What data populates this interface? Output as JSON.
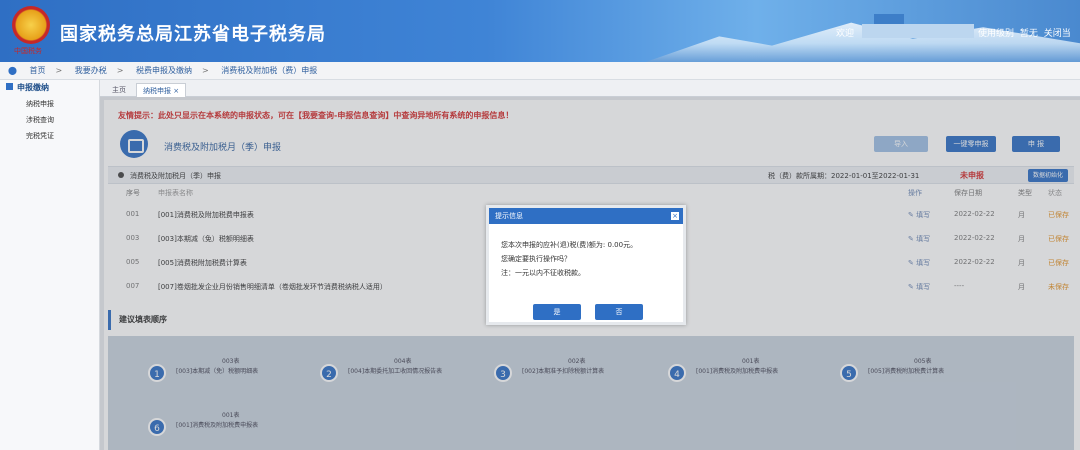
{
  "header": {
    "site_title": "国家税务总局江苏省电子税务局",
    "emblem_text": "中国税务",
    "welcome": "欢迎",
    "links": [
      "使用级别",
      "暂无",
      "关闭当"
    ]
  },
  "breadcrumb": [
    "首页",
    "我要办税",
    "税费申报及缴纳",
    "消费税及附加税（费）申报"
  ],
  "sidebar": {
    "heading": "申报缴纳",
    "items": [
      "纳税申报",
      "涉税查询",
      "完税凭证"
    ]
  },
  "tabs": {
    "home": "主页",
    "active": "纳税申报 ×"
  },
  "main": {
    "tip": "友情提示：此处只显示在本系统的申报状态，可在【我要查询-申报信息查询】中查询异地所有系统的申报信息！",
    "form_title": "消费税及附加税月（季）申报",
    "buttons": [
      "导入",
      "一键零申报",
      "申 报"
    ],
    "bar_label": "消费税及附加税月（季）申报",
    "period": "税（费）款所属期：2022-01-01至2022-01-31",
    "status": "未申报",
    "bar_button": "数据初始化",
    "columns": {
      "no": "序号",
      "name": "申报表名称",
      "op": "操作",
      "date": "保存日期",
      "type": "类型",
      "status": "状态"
    },
    "rows": [
      {
        "no": "001",
        "name": "[001]消费税及附加税费申报表",
        "op": "✎ 填写",
        "date": "2022-02-22",
        "type": "月",
        "status": "已保存"
      },
      {
        "no": "003",
        "name": "[003]本期减（免）税额明细表",
        "op": "✎ 填写",
        "date": "2022-02-22",
        "type": "月",
        "status": "已保存"
      },
      {
        "no": "005",
        "name": "[005]消费税附加税费计算表",
        "op": "✎ 填写",
        "date": "2022-02-22",
        "type": "月",
        "status": "已保存"
      },
      {
        "no": "007",
        "name": "[007]卷烟批发企业月份销售明细清单（卷烟批发环节消费税纳税人适用）",
        "op": "✎ 填写",
        "date": "----",
        "type": "月",
        "status": "未保存"
      }
    ],
    "suggest_heading": "建议填表顺序",
    "steps": [
      {
        "num": "1",
        "code": "003表",
        "name": "[003]本期减（免）税额明细表"
      },
      {
        "num": "2",
        "code": "004表",
        "name": "[004]本期委托加工收回情况报告表"
      },
      {
        "num": "3",
        "code": "002表",
        "name": "[002]本期准予扣除税额计算表"
      },
      {
        "num": "4",
        "code": "001表",
        "name": "[001]消费税及附加税费申报表"
      },
      {
        "num": "5",
        "code": "005表",
        "name": "[005]消费税附加税费计算表"
      },
      {
        "num": "6",
        "code": "001表",
        "name": "[001]消费税及附加税费申报表"
      }
    ]
  },
  "modal": {
    "title": "提示信息",
    "close": "×",
    "lines": [
      "您本次申报的应补(退)税(费)额为: 0.00元。",
      "您确定要执行操作吗？",
      "注：一元以内不征收税款。"
    ],
    "yes": "是",
    "no": "否"
  }
}
